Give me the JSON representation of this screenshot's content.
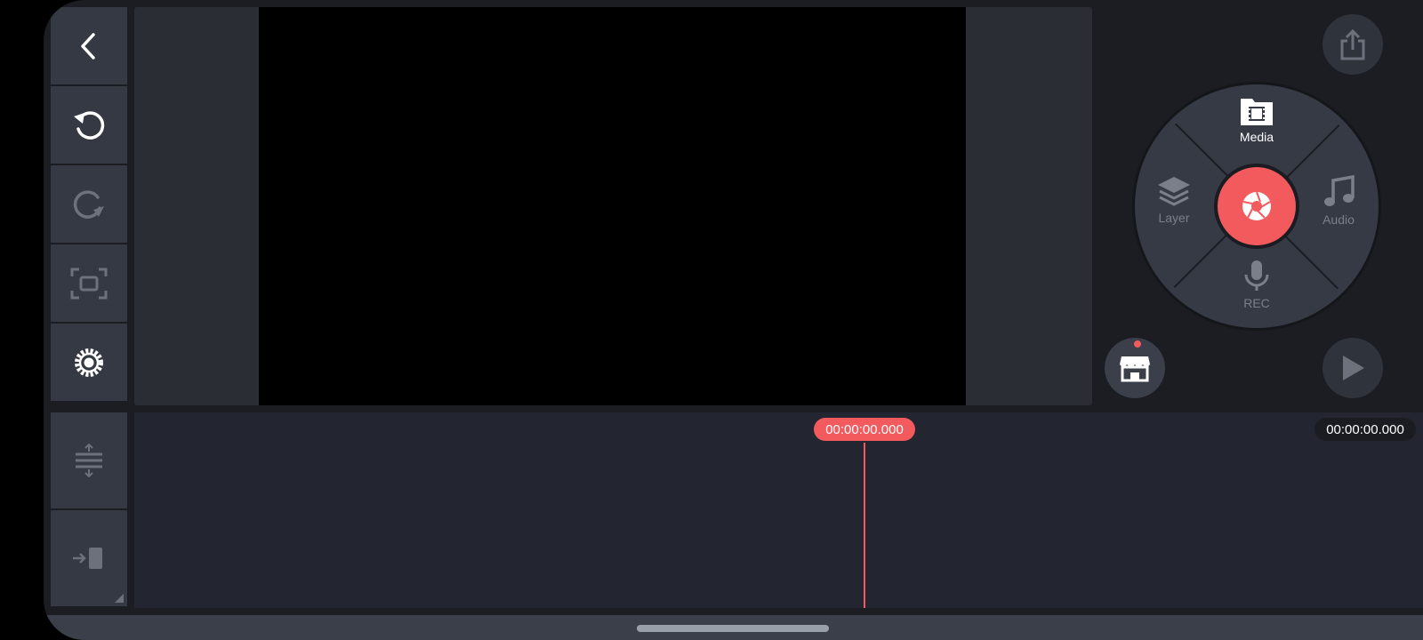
{
  "toolbar": {
    "back_icon": "chevron-left-icon",
    "undo_icon": "undo-icon",
    "redo_icon": "redo-icon",
    "fullscreen_icon": "fullscreen-icon",
    "settings_icon": "gear-icon"
  },
  "media_wheel": {
    "media_label": "Media",
    "layer_label": "Layer",
    "audio_label": "Audio",
    "rec_label": "REC",
    "center_icon": "camera-shutter-icon"
  },
  "timeline": {
    "playhead_time": "00:00:00.000",
    "total_time": "00:00:00.000",
    "expand_icon": "expand-tracks-icon",
    "jump_icon": "jump-to-end-icon"
  },
  "colors": {
    "accent": "#f25a5e",
    "panel": "#343944",
    "background": "#1b1d23"
  }
}
